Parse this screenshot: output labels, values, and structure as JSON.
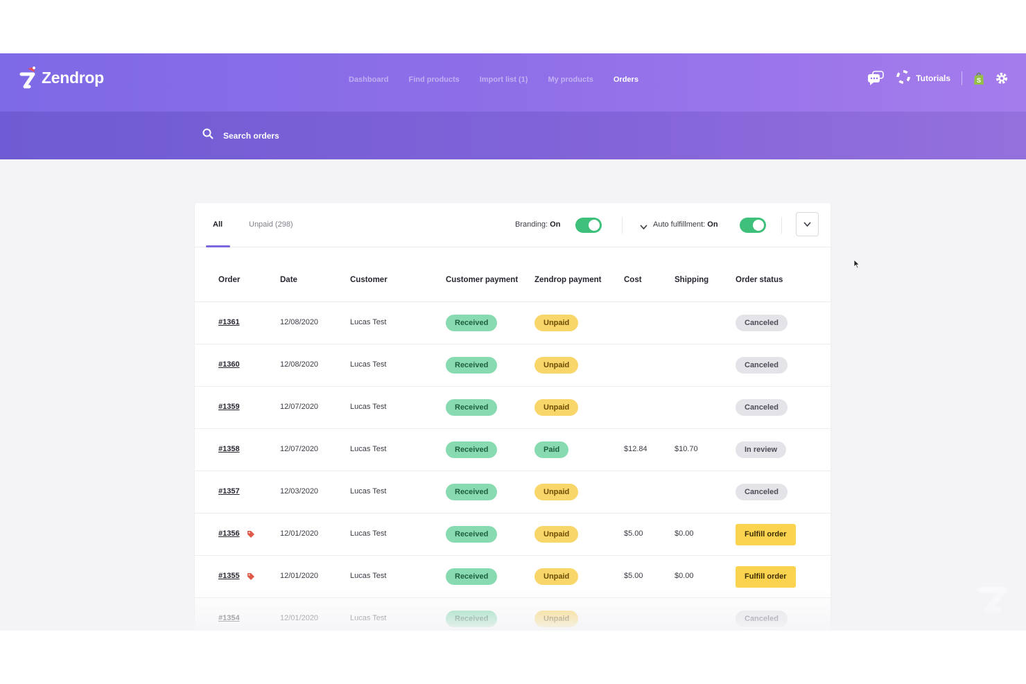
{
  "app": {
    "brand": "Zendrop"
  },
  "nav": {
    "items": [
      {
        "label": "Dashboard",
        "active": false
      },
      {
        "label": "Find products",
        "active": false
      },
      {
        "label": "Import list (1)",
        "active": false
      },
      {
        "label": "My products",
        "active": false
      },
      {
        "label": "Orders",
        "active": true
      }
    ]
  },
  "header_right": {
    "chat_icon": "chat-bubbles-icon",
    "tutorials_icon": "lifebuoy-icon",
    "tutorials_label": "Tutorials",
    "store_icon": "shopify-bag-icon",
    "settings_icon": "gear-icon"
  },
  "search": {
    "placeholder": "Search orders",
    "value": ""
  },
  "tabs": [
    {
      "label": "All",
      "active": true
    },
    {
      "label": "Unpaid (298)",
      "active": false
    }
  ],
  "toggles": {
    "branding": {
      "label": "Branding:",
      "state": "On",
      "on": true
    },
    "auto_fulfillment": {
      "label": "Auto fulfillment:",
      "state": "On",
      "on": true
    }
  },
  "table": {
    "columns": [
      "Order",
      "Date",
      "Customer",
      "Customer payment",
      "Zendrop payment",
      "Cost",
      "Shipping",
      "Order status"
    ],
    "rows": [
      {
        "order": "#1361",
        "tag": false,
        "date": "12/08/2020",
        "customer": "Lucas Test",
        "customer_payment": "Received",
        "zendrop_payment": "Unpaid",
        "cost": "",
        "shipping": "",
        "status": "Canceled"
      },
      {
        "order": "#1360",
        "tag": false,
        "date": "12/08/2020",
        "customer": "Lucas Test",
        "customer_payment": "Received",
        "zendrop_payment": "Unpaid",
        "cost": "",
        "shipping": "",
        "status": "Canceled"
      },
      {
        "order": "#1359",
        "tag": false,
        "date": "12/07/2020",
        "customer": "Lucas Test",
        "customer_payment": "Received",
        "zendrop_payment": "Unpaid",
        "cost": "",
        "shipping": "",
        "status": "Canceled"
      },
      {
        "order": "#1358",
        "tag": false,
        "date": "12/07/2020",
        "customer": "Lucas Test",
        "customer_payment": "Received",
        "zendrop_payment": "Paid",
        "cost": "$12.84",
        "shipping": "$10.70",
        "status": "In review"
      },
      {
        "order": "#1357",
        "tag": false,
        "date": "12/03/2020",
        "customer": "Lucas Test",
        "customer_payment": "Received",
        "zendrop_payment": "Unpaid",
        "cost": "",
        "shipping": "",
        "status": "Canceled"
      },
      {
        "order": "#1356",
        "tag": true,
        "date": "12/01/2020",
        "customer": "Lucas Test",
        "customer_payment": "Received",
        "zendrop_payment": "Unpaid",
        "cost": "$5.00",
        "shipping": "$0.00",
        "status": "Fulfill order"
      },
      {
        "order": "#1355",
        "tag": true,
        "date": "12/01/2020",
        "customer": "Lucas Test",
        "customer_payment": "Received",
        "zendrop_payment": "Unpaid",
        "cost": "$5.00",
        "shipping": "$0.00",
        "status": "Fulfill order"
      },
      {
        "order": "#1354",
        "tag": false,
        "date": "12/01/2020",
        "customer": "Lucas Test",
        "customer_payment": "Received",
        "zendrop_payment": "Unpaid",
        "cost": "",
        "shipping": "",
        "status": "Canceled"
      }
    ]
  },
  "colors": {
    "header_start": "#7e69e6",
    "header_end": "#a57cec",
    "toggle_on": "#3ec07b",
    "received": "#88dbb1",
    "unpaid": "#f8d66a",
    "status_grey": "#e3e3e8",
    "fulfill": "#fbd34f"
  }
}
